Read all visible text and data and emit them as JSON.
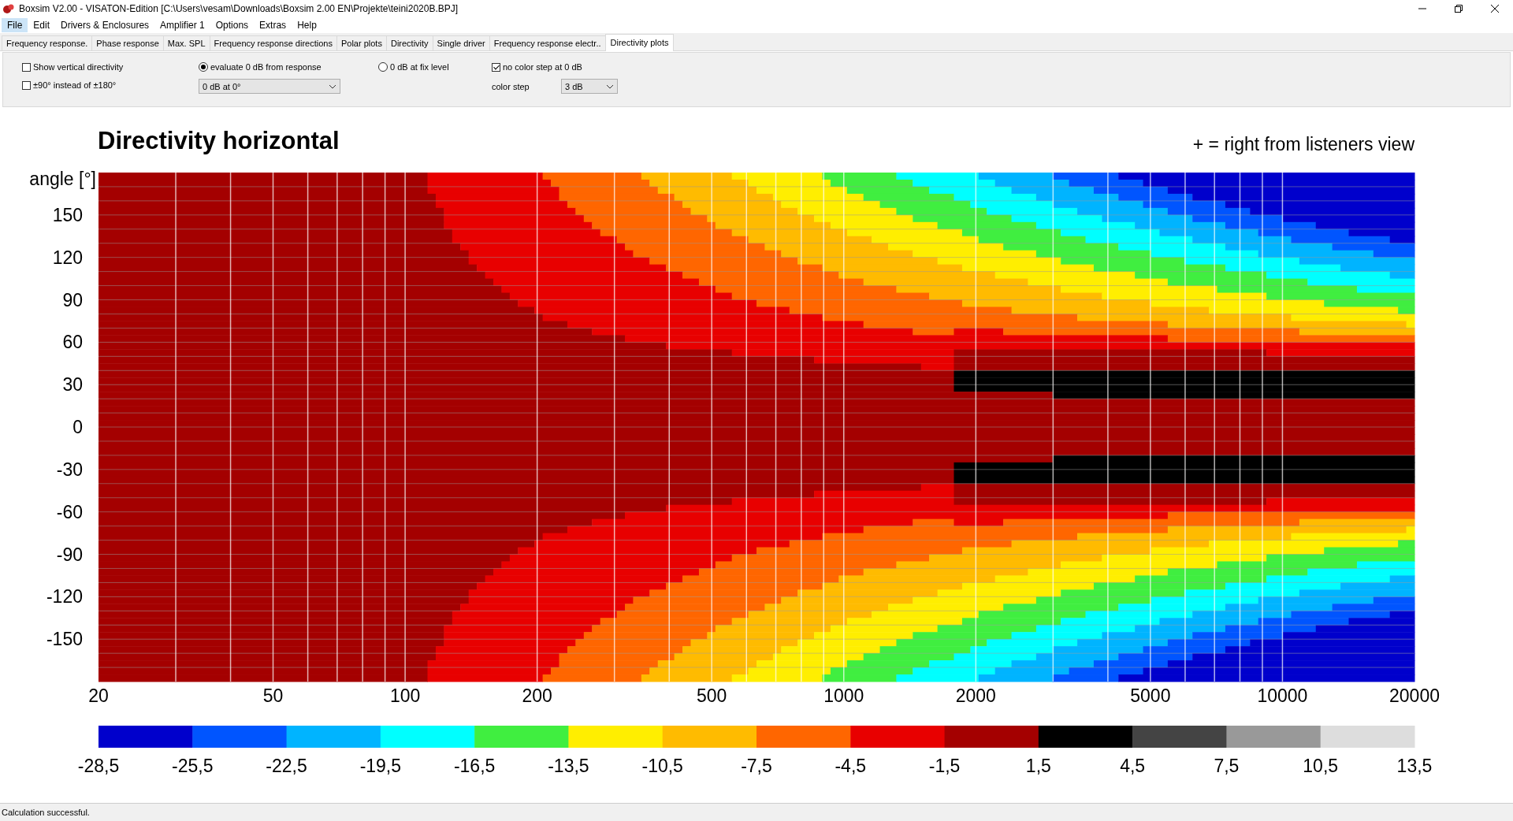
{
  "window": {
    "title": "Boxsim V2.00 - VISATON-Edition [C:\\Users\\vesam\\Downloads\\Boxsim 2.00 EN\\Projekte\\teini2020B.BPJ]"
  },
  "menu": [
    {
      "label": "File",
      "selected": true
    },
    {
      "label": "Edit",
      "selected": false
    },
    {
      "label": "Drivers & Enclosures",
      "selected": false
    },
    {
      "label": "Amplifier 1",
      "selected": false
    },
    {
      "label": "Options",
      "selected": false
    },
    {
      "label": "Extras",
      "selected": false
    },
    {
      "label": "Help",
      "selected": false
    }
  ],
  "tabs": [
    {
      "label": "Frequency response.",
      "selected": false
    },
    {
      "label": "Phase response",
      "selected": false
    },
    {
      "label": "Max. SPL",
      "selected": false
    },
    {
      "label": "Frequency response directions",
      "selected": false
    },
    {
      "label": "Polar plots",
      "selected": false
    },
    {
      "label": "Directivity",
      "selected": false
    },
    {
      "label": "Single driver",
      "selected": false
    },
    {
      "label": "Frequency response electr..",
      "selected": false
    },
    {
      "label": "Directivity plots",
      "selected": true
    }
  ],
  "options": {
    "show_vertical": {
      "label": "Show vertical directivity",
      "checked": false
    },
    "half_range": {
      "label": "±90° instead of ±180°",
      "checked": false
    },
    "radios": [
      {
        "label": "evaluate 0 dB from response",
        "selected": true
      },
      {
        "label": "0 dB at fix level",
        "selected": false
      }
    ],
    "reference": {
      "value": "0 dB at 0°"
    },
    "no_color_step": {
      "label": "no color step at 0 dB",
      "checked": true
    },
    "color_step": {
      "label": "color step",
      "value": "3 dB"
    }
  },
  "chart": {
    "title": "Directivity horizontal",
    "note": "+ = right from listeners view",
    "ylabel": "angle [°]",
    "yticks": [
      "150",
      "120",
      "90",
      "60",
      "30",
      "0",
      "-30",
      "-60",
      "-90",
      "-120",
      "-150"
    ],
    "xticks": [
      "20",
      "50",
      "100",
      "200",
      "500",
      "1000",
      "2000",
      "5000",
      "10000",
      "20000"
    ]
  },
  "colorbar": {
    "colors": [
      {
        "color": "#0000cc"
      },
      {
        "color": "#0055ff"
      },
      {
        "color": "#00b4ff"
      },
      {
        "color": "#00ffff"
      },
      {
        "color": "#40ee40"
      },
      {
        "color": "#ffee00"
      },
      {
        "color": "#ffbb00"
      },
      {
        "color": "#ff6600"
      },
      {
        "color": "#e80000"
      },
      {
        "color": "#a40000"
      },
      {
        "color": "#000000"
      },
      {
        "color": "#444444"
      },
      {
        "color": "#999999"
      },
      {
        "color": "#dddddd"
      }
    ],
    "labels": [
      "-28,5",
      "-25,5",
      "-22,5",
      "-19,5",
      "-16,5",
      "-13,5",
      "-10,5",
      "-7,5",
      "-4,5",
      "-1,5",
      "1,5",
      "4,5",
      "7,5",
      "10,5",
      "13,5"
    ]
  },
  "status_bar": {
    "text": "Calculation successful."
  }
}
